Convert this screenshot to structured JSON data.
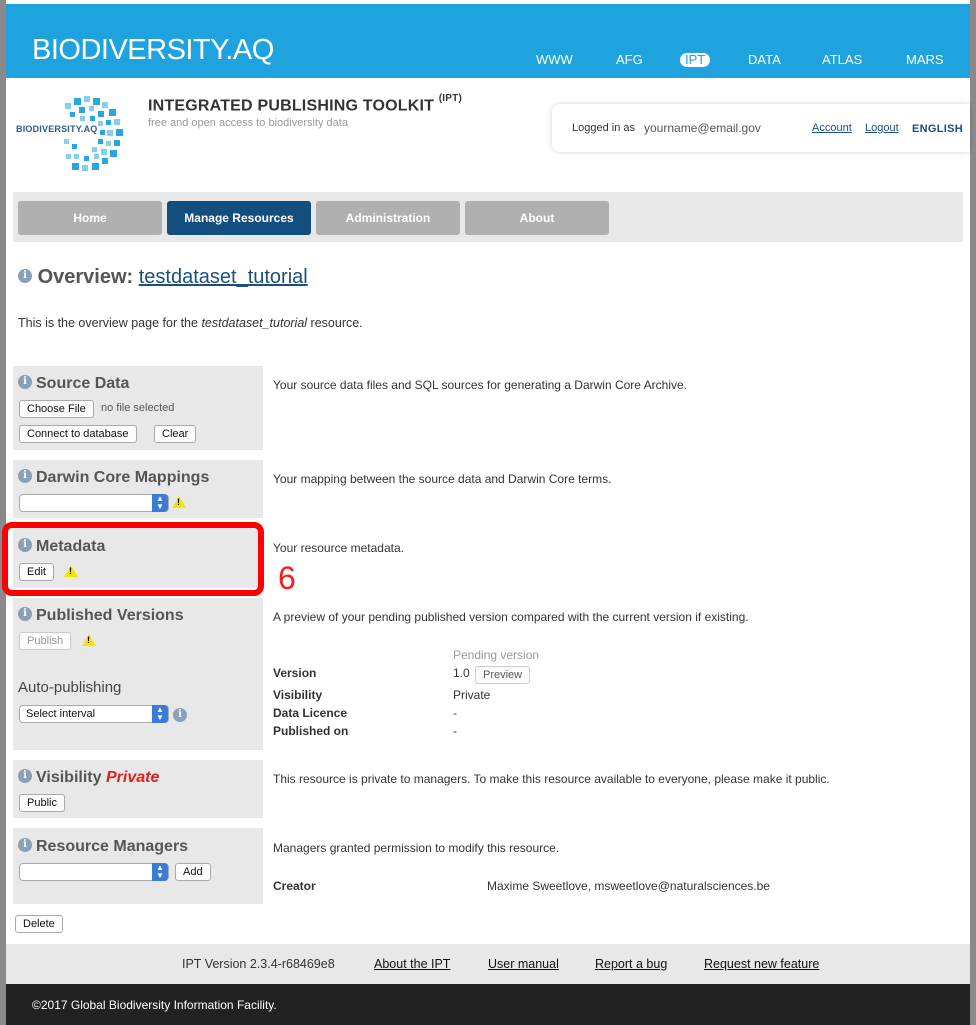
{
  "topbar": {
    "brand": "BIODIVERSITY.AQ",
    "nav": [
      "WWW",
      "AFG",
      "IPT",
      "DATA",
      "ATLAS",
      "MARS"
    ],
    "active_nav": "IPT"
  },
  "header": {
    "logo_text": "BIODIVERSITY.AQ",
    "title": "INTEGRATED PUBLISHING TOOLKIT",
    "title_sup": "(IPT)",
    "subtitle": "free and open access to biodiversity data",
    "logged_in_label": "Logged in as",
    "user_email": "yourname@email.gov",
    "account": "Account",
    "logout": "Logout",
    "language": "ENGLISH"
  },
  "mainnav": {
    "items": [
      "Home",
      "Manage Resources",
      "Administration",
      "About"
    ],
    "active": "Manage Resources"
  },
  "overview": {
    "heading_prefix": "Overview:",
    "resource_name": "testdataset_tutorial",
    "desc_before": "This is the overview page for the",
    "desc_after": "resource."
  },
  "source_data": {
    "title": "Source Data",
    "choose_file": "Choose File",
    "no_file": "no file selected",
    "connect": "Connect to database",
    "clear": "Clear",
    "description": "Your source data files and SQL sources for generating a Darwin Core Archive."
  },
  "dwc_mappings": {
    "title": "Darwin Core Mappings",
    "description": "Your mapping between the source data and Darwin Core terms."
  },
  "metadata": {
    "title": "Metadata",
    "edit": "Edit",
    "description": "Your resource metadata.",
    "step_number": "6"
  },
  "published_versions": {
    "title": "Published Versions",
    "publish": "Publish",
    "description": "A preview of your pending published version compared with the current version if existing.",
    "auto_publishing": "Auto-publishing",
    "interval_select": "Select interval",
    "pending_version_header": "Pending version",
    "rows": [
      {
        "label": "Version",
        "value": "1.0"
      },
      {
        "label": "Visibility",
        "value": "Private"
      },
      {
        "label": "Data Licence",
        "value": "-"
      },
      {
        "label": "Published on",
        "value": "-"
      }
    ],
    "preview": "Preview"
  },
  "visibility": {
    "title": "Visibility",
    "status": "Private",
    "public_button": "Public",
    "description": "This resource is private to managers. To make this resource available to everyone, please make it public."
  },
  "resource_managers": {
    "title": "Resource Managers",
    "add": "Add",
    "description": "Managers granted permission to modify this resource.",
    "creator_label": "Creator",
    "creator_value": "Maxime Sweetlove, msweetlove@naturalsciences.be"
  },
  "delete_button": "Delete",
  "footer": {
    "version": "IPT Version 2.3.4-r68469e8",
    "links": [
      "About the IPT",
      "User manual",
      "Report a bug",
      "Request new feature"
    ],
    "copyright": "©2017 Global Biodiversity Information Facility."
  },
  "colors": {
    "topbar": "#1fa3df",
    "active_nav": "#134f7e",
    "link": "#1c4f80",
    "highlight": "#ff0000",
    "private_red": "#e0201b"
  }
}
